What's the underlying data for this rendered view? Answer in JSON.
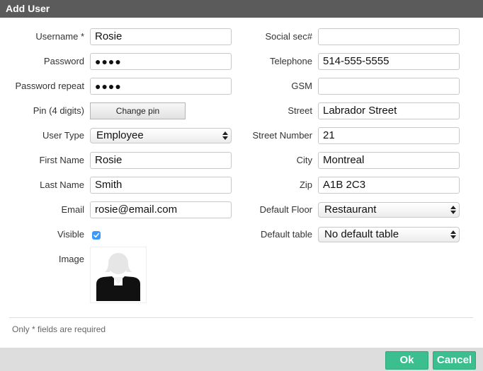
{
  "dialog": {
    "title": "Add User"
  },
  "left": {
    "username": {
      "label": "Username *",
      "value": "Rosie"
    },
    "password": {
      "label": "Password",
      "value": "●●●●"
    },
    "password_repeat": {
      "label": "Password repeat",
      "value": "●●●●"
    },
    "pin": {
      "label": "Pin (4 digits)",
      "button": "Change pin"
    },
    "user_type": {
      "label": "User Type",
      "value": "Employee"
    },
    "first_name": {
      "label": "First Name",
      "value": "Rosie"
    },
    "last_name": {
      "label": "Last Name",
      "value": "Smith"
    },
    "email": {
      "label": "Email",
      "value": "rosie@email.com"
    },
    "visible": {
      "label": "Visible",
      "checked": true
    },
    "image": {
      "label": "Image",
      "icon": "user-avatar-icon"
    }
  },
  "right": {
    "social_sec": {
      "label": "Social sec#",
      "value": ""
    },
    "telephone": {
      "label": "Telephone",
      "value": "514-555-5555"
    },
    "gsm": {
      "label": "GSM",
      "value": ""
    },
    "street": {
      "label": "Street",
      "value": "Labrador Street"
    },
    "street_number": {
      "label": "Street Number",
      "value": "21"
    },
    "city": {
      "label": "City",
      "value": "Montreal"
    },
    "zip": {
      "label": "Zip",
      "value": "A1B 2C3"
    },
    "default_floor": {
      "label": "Default Floor",
      "value": "Restaurant"
    },
    "default_table": {
      "label": "Default table",
      "value": "No default table"
    }
  },
  "note": "Only * fields are required",
  "footer": {
    "ok_label": "Ok",
    "cancel_label": "Cancel"
  },
  "colors": {
    "titlebar": "#5b5b5b",
    "primary_button": "#3cbf8f",
    "checkbox": "#3b99fc"
  }
}
